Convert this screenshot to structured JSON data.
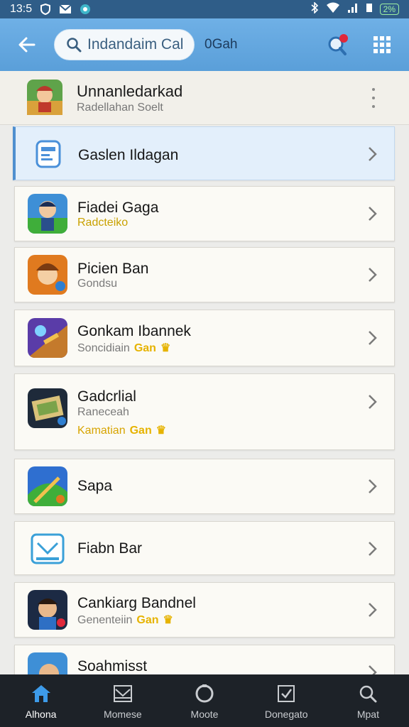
{
  "status": {
    "time": "13:5",
    "battery": "2%"
  },
  "appbar": {
    "search_text": "Indandaim Cal",
    "extra_text": "0Gah"
  },
  "header": {
    "title": "Unnanledarkad",
    "subtitle": "Radellahan  Soelt"
  },
  "rows": [
    {
      "title": "Gaslen Ildagan",
      "sub": "",
      "sub2": "",
      "tag": ""
    },
    {
      "title": "Fiadei Gaga",
      "sub": "Radcteiko",
      "sub2": "",
      "tag": ""
    },
    {
      "title": "Picien Ban",
      "sub": "Gondsu",
      "sub2": "",
      "tag": ""
    },
    {
      "title": "Gonkam Ibannek",
      "sub": "Soncidiain",
      "sub2": "",
      "tag": "Gan"
    },
    {
      "title": "Gadcrlial",
      "sub": "Raneceah",
      "sub2": "Kamatian",
      "tag": "Gan"
    },
    {
      "title": "Sapa",
      "sub": "",
      "sub2": "",
      "tag": ""
    },
    {
      "title": "Fiabn Bar",
      "sub": "",
      "sub2": "",
      "tag": ""
    },
    {
      "title": "Cankiarg Bandnel",
      "sub": "Genenteiin",
      "sub2": "",
      "tag": "Gan"
    },
    {
      "title": "Soahmisst",
      "sub": "",
      "sub2": "",
      "tag": ""
    }
  ],
  "bottom_nav": [
    {
      "label": "Alhona",
      "icon": "home-icon"
    },
    {
      "label": "Momese",
      "icon": "inbox-icon"
    },
    {
      "label": "Moote",
      "icon": "circle-icon"
    },
    {
      "label": "Donegato",
      "icon": "checkbox-icon"
    },
    {
      "label": "Mpat",
      "icon": "search-icon"
    }
  ],
  "colors": {
    "appbar": "#5a9fd9",
    "accent_gold": "#e6b300",
    "active_row": "#e3effb",
    "nav_bg": "#1d2228"
  }
}
